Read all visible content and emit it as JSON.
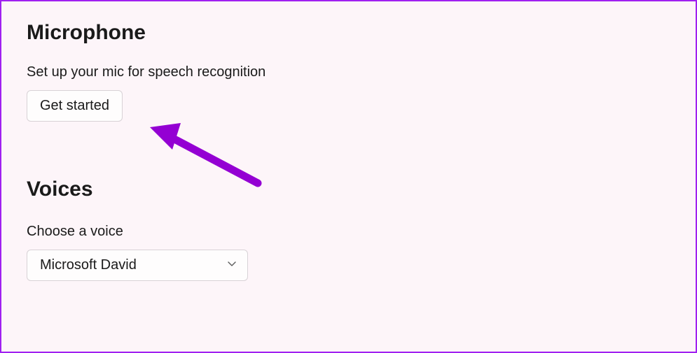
{
  "microphone": {
    "heading": "Microphone",
    "description": "Set up your mic for speech recognition",
    "button_label": "Get started"
  },
  "voices": {
    "heading": "Voices",
    "label": "Choose a voice",
    "selected": "Microsoft David"
  },
  "annotation": {
    "arrow_color": "#9400d3"
  }
}
